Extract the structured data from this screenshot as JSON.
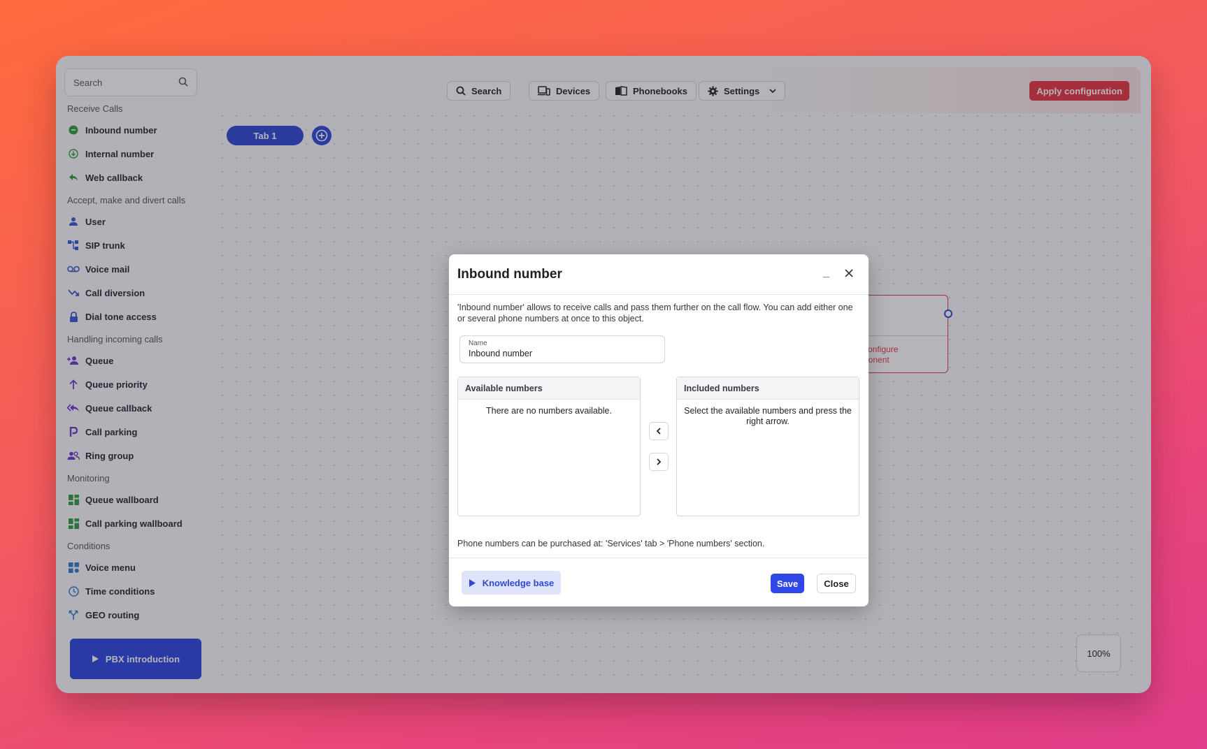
{
  "sidebar": {
    "search_label": "Search",
    "sections": [
      {
        "title": "Receive Calls",
        "items": [
          {
            "label": "Inbound number",
            "icon": "inbound-icon",
            "color": "#2e9b3e"
          },
          {
            "label": "Internal number",
            "icon": "internal-icon",
            "color": "#2e9b3e"
          },
          {
            "label": "Web callback",
            "icon": "web-callback-icon",
            "color": "#2e9b3e"
          }
        ]
      },
      {
        "title": "Accept, make and divert calls",
        "items": [
          {
            "label": "User",
            "icon": "user-icon",
            "color": "#3a55d6"
          },
          {
            "label": "SIP trunk",
            "icon": "sip-trunk-icon",
            "color": "#3a55d6"
          },
          {
            "label": "Voice mail",
            "icon": "voicemail-icon",
            "color": "#3a55d6"
          },
          {
            "label": "Call diversion",
            "icon": "call-diversion-icon",
            "color": "#3a55d6"
          },
          {
            "label": "Dial tone access",
            "icon": "lock-icon",
            "color": "#3a55d6"
          }
        ]
      },
      {
        "title": "Handling incoming calls",
        "items": [
          {
            "label": "Queue",
            "icon": "queue-icon",
            "color": "#6a37c9"
          },
          {
            "label": "Queue priority",
            "icon": "arrow-up-icon",
            "color": "#6a37c9"
          },
          {
            "label": "Queue callback",
            "icon": "queue-callback-icon",
            "color": "#6a37c9"
          },
          {
            "label": "Call parking",
            "icon": "parking-icon",
            "color": "#6a37c9"
          },
          {
            "label": "Ring group",
            "icon": "group-icon",
            "color": "#6a37c9"
          }
        ]
      },
      {
        "title": "Monitoring",
        "items": [
          {
            "label": "Queue wallboard",
            "icon": "dashboard-icon",
            "color": "#2e9b3e"
          },
          {
            "label": "Call parking wallboard",
            "icon": "dashboard-icon",
            "color": "#2e9b3e"
          }
        ]
      },
      {
        "title": "Conditions",
        "items": [
          {
            "label": "Voice menu",
            "icon": "voice-menu-icon",
            "color": "#2e7bcf"
          },
          {
            "label": "Time conditions",
            "icon": "clock-icon",
            "color": "#2e7bcf"
          },
          {
            "label": "GEO routing",
            "icon": "geo-routing-icon",
            "color": "#2e7bcf"
          }
        ]
      }
    ],
    "pbx_intro_label": "PBX introduction"
  },
  "toolbar": {
    "search_label": "Search",
    "devices_label": "Devices",
    "phonebooks_label": "Phonebooks",
    "settings_label": "Settings",
    "apply_label": "Apply configuration"
  },
  "tabs": [
    {
      "label": "Tab 1"
    }
  ],
  "canvas": {
    "node_text_line1": "configure",
    "node_text_line2": "ponent",
    "zoom_label": "100%"
  },
  "modal": {
    "title": "Inbound number",
    "minimize_label": "_",
    "description": "'Inbound number' allows to receive calls and pass them further on the call flow. You can add either one or several phone numbers at once to this object.",
    "name_label": "Name",
    "name_value": "Inbound number",
    "available_header": "Available numbers",
    "available_empty": "There are no numbers available.",
    "included_header": "Included numbers",
    "included_empty": "Select the available numbers and press the right arrow.",
    "note": "Phone numbers can be purchased at: 'Services' tab > 'Phone numbers' section.",
    "knowledge_base_label": "Knowledge base",
    "save_label": "Save",
    "close_label": "Close"
  },
  "colors": {
    "accent": "#2f47e6",
    "danger": "#e8343f"
  }
}
